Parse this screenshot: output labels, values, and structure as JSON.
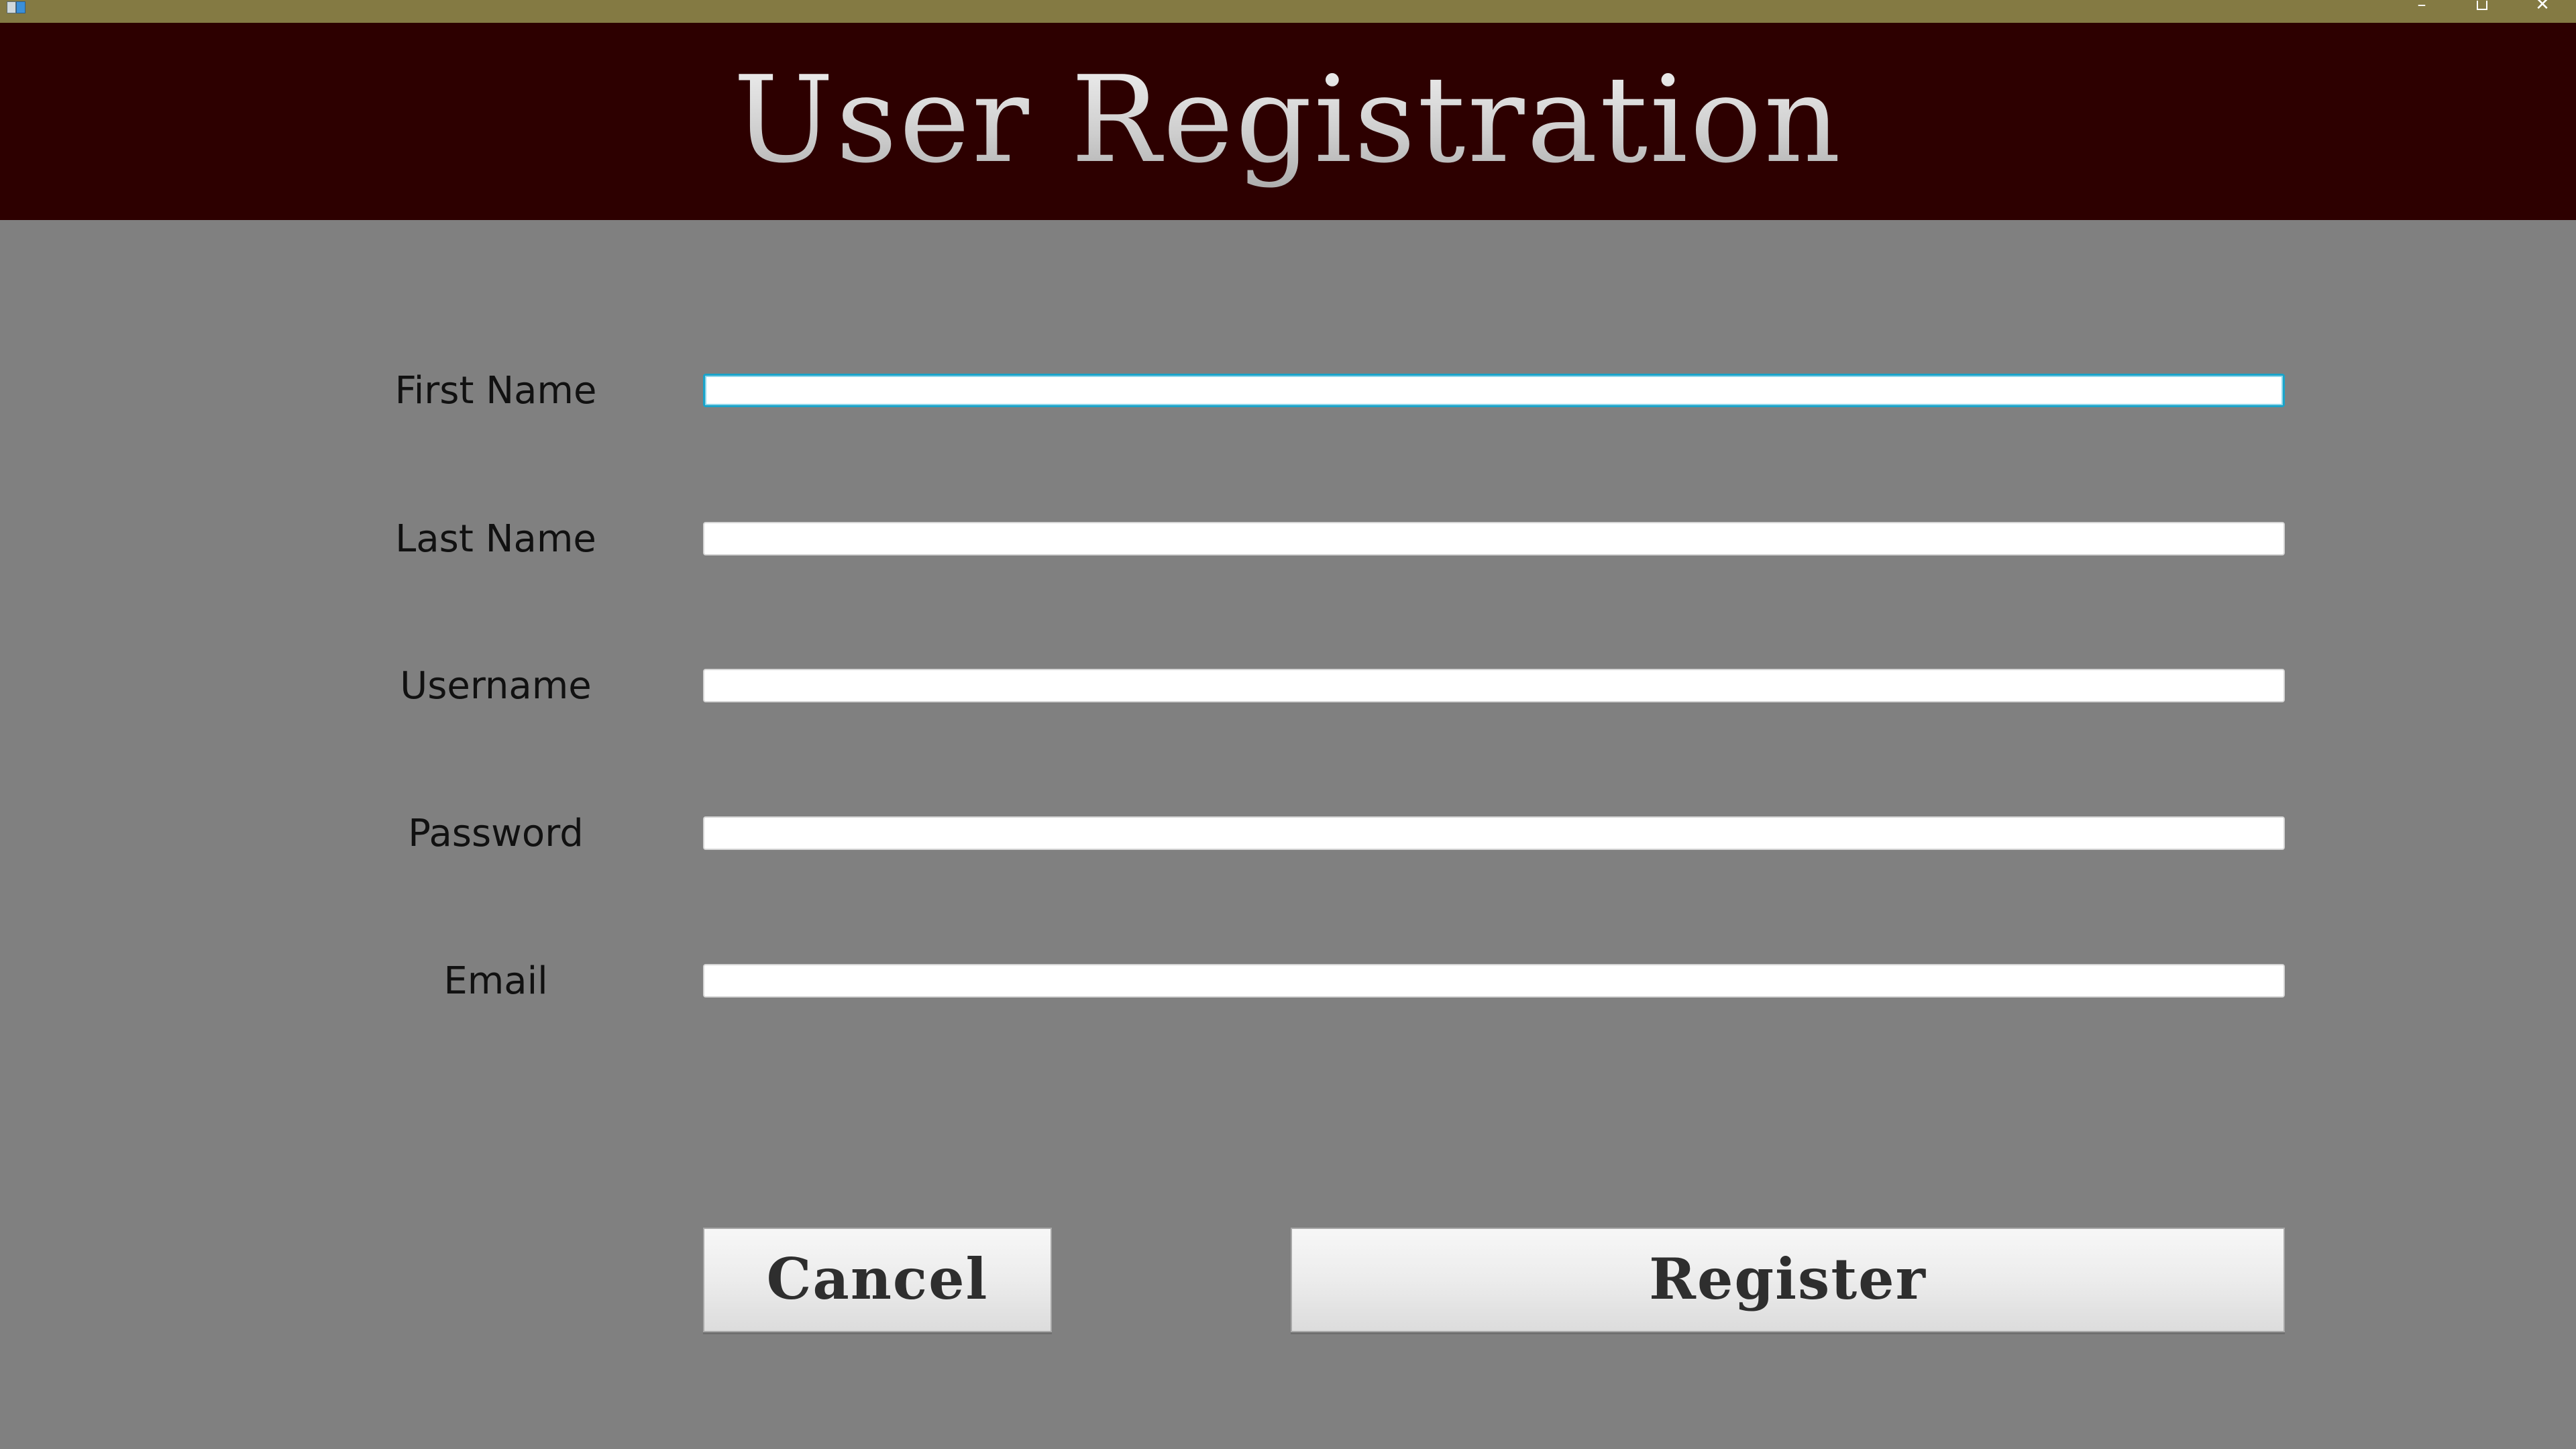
{
  "window": {
    "controls": {
      "minimize": "–",
      "close": "✕"
    }
  },
  "header": {
    "title": "User Registration"
  },
  "form": {
    "fields": [
      {
        "label": "First Name",
        "value": "",
        "focused": true
      },
      {
        "label": "Last Name",
        "value": ""
      },
      {
        "label": "Username",
        "value": ""
      },
      {
        "label": "Password",
        "value": ""
      },
      {
        "label": "Email",
        "value": ""
      }
    ]
  },
  "buttons": {
    "cancel_label": "Cancel",
    "register_label": "Register"
  },
  "colors": {
    "titlebar": "#847a43",
    "banner": "#2d0000",
    "background": "#808080",
    "focus_border": "#1aa3c9"
  },
  "icons": {
    "app": "app-icon",
    "minimize": "minimize-icon",
    "maximize": "maximize-icon",
    "close": "close-icon"
  }
}
